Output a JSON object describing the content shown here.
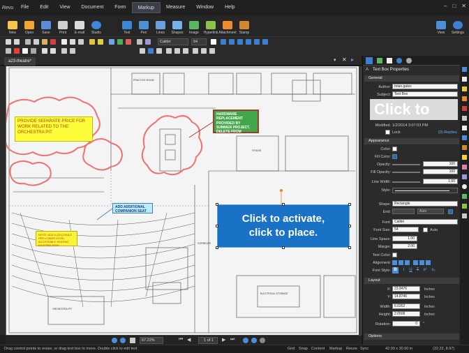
{
  "menu": {
    "logo": "Revu",
    "items": [
      "File",
      "Edit",
      "View",
      "Document",
      "Form",
      "Markup",
      "Measure",
      "Window",
      "Help"
    ],
    "active": "Markup"
  },
  "ribbon": {
    "left": [
      "New",
      "Open",
      "Save",
      "Print",
      "E-mail",
      "Studio"
    ],
    "middle": [
      "Text",
      "Pen",
      "Lines",
      "Shapes",
      "Image",
      "Hyperlink",
      "Attachment",
      "Stamp"
    ],
    "right": [
      "View",
      "Settings"
    ]
  },
  "toolbar": {
    "font": "Calibri",
    "font_size": "54"
  },
  "tab": {
    "name": "a23-theatre*"
  },
  "canvas": {
    "yellow_note": "PROVIDE SEPARATE PRICE FOR WORK RELATED TO THE ORCHESTRA PIT",
    "green_note": "HARDWARE REPLACEMENT PROVIDED BY SUMMER PROJECT, DELETE FROM SCOPE.",
    "cyan_note": "ADD ADDITIONAL COMPANION SEAT",
    "small_note": "NOTE: ADD 6 (SIX) RAILS PER LOWER LEVEL ACCESSIBLE SEATING EXISTING SEAT",
    "blue_box_line1": "Click to activate,",
    "blue_box_line2": "click to place.",
    "labels": [
      "PRACTICE ROOM",
      "STAGE",
      "CORRIDOR",
      "ELECTRICAL STORAGE",
      "ORCHESTRA PIT"
    ]
  },
  "nav": {
    "zoom": "67.22%",
    "page": "1 of 1"
  },
  "status": {
    "hint": "Drag control points to resize, or drag text box to move. Double click to edit text",
    "items": [
      "Grid",
      "Snap",
      "Content",
      "Markup",
      "Reuse",
      "Sync"
    ],
    "size": "42.00 x 30.00 in",
    "coords": "(22.22, 8.97)"
  },
  "panel": {
    "title": "Text Box Properties",
    "general": {
      "header": "General",
      "author_label": "Author:",
      "author": "brian.gates",
      "subject_label": "Subject:",
      "subject": "Text Box",
      "preview": "Click to",
      "modified_label": "Modified:",
      "modified": "1/2/2014 3:07:03 PM",
      "lock_label": "Lock",
      "replies": "(0) Replies"
    },
    "appearance": {
      "header": "Appearance",
      "color_label": "Color:",
      "fill_label": "Fill Color:",
      "opacity_label": "Opacity:",
      "opacity": "100",
      "fill_opacity_label": "Fill Opacity:",
      "fill_opacity": "100",
      "line_width_label": "Line Width:",
      "line_width": "1.00",
      "style_label": "Style:",
      "shape_label": "Shape:",
      "shape": "Rectangle",
      "end_label": "End:",
      "end_value": "Auto",
      "font_label": "Font:",
      "font": "Calibri",
      "font_size_label": "Font Size:",
      "font_size": "54",
      "auto_label": "Auto",
      "line_space_label": "Line Space:",
      "line_space": "1.00",
      "margin_label": "Margin:",
      "margin": "2.00",
      "text_color_label": "Text Color:",
      "alignment_label": "Alignment:",
      "font_style_label": "Font Style:"
    },
    "layout": {
      "header": "Layout",
      "x_label": "X:",
      "x": "23.8476",
      "y_label": "Y:",
      "y": "14.8746",
      "width_label": "Width:",
      "width": "6.0262",
      "height_label": "Height:",
      "height": "2.0508",
      "unit": "Inches",
      "rotation_label": "Rotation:",
      "rotation": "0",
      "rotation_unit": "°"
    },
    "options": {
      "header": "Options"
    }
  },
  "colors": {
    "accent": "#1972c6",
    "note_yellow": "#fdfd3c",
    "note_green": "#42a64a",
    "cloud_red": "#f07070"
  }
}
